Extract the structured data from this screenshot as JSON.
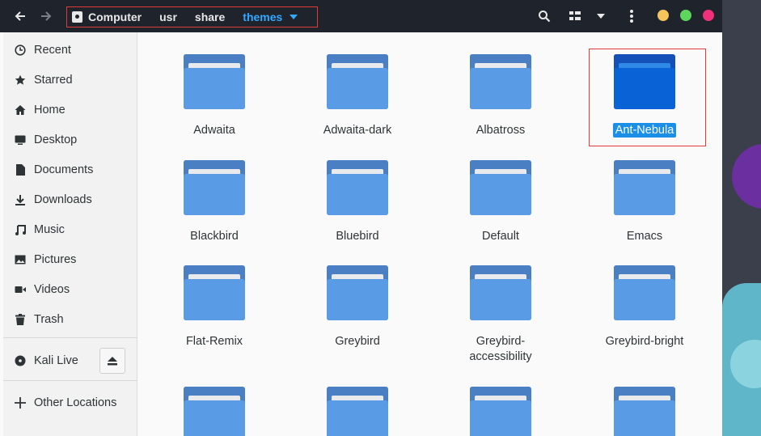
{
  "header": {
    "breadcrumbs": [
      "Computer",
      "usr",
      "share",
      "themes"
    ],
    "icons": {
      "back": "arrow-left-icon",
      "forward": "arrow-right-icon",
      "search": "search-icon",
      "view": "view-options-icon",
      "sort": "chevron-down-icon",
      "menu": "kebab-menu-icon"
    },
    "window_controls": {
      "minimize_color": "#f4c55b",
      "maximize_color": "#5ed65e",
      "close_color": "#f0307a"
    }
  },
  "sidebar": {
    "places": [
      {
        "label": "Recent",
        "icon": "clock-icon"
      },
      {
        "label": "Starred",
        "icon": "star-icon"
      },
      {
        "label": "Home",
        "icon": "home-icon"
      },
      {
        "label": "Desktop",
        "icon": "desktop-icon"
      },
      {
        "label": "Documents",
        "icon": "document-icon"
      },
      {
        "label": "Downloads",
        "icon": "download-icon"
      },
      {
        "label": "Music",
        "icon": "music-icon"
      },
      {
        "label": "Pictures",
        "icon": "picture-icon"
      },
      {
        "label": "Videos",
        "icon": "video-icon"
      },
      {
        "label": "Trash",
        "icon": "trash-icon"
      }
    ],
    "devices": [
      {
        "label": "Kali Live",
        "icon": "disc-icon"
      }
    ],
    "other": {
      "label": "Other Locations",
      "icon": "plus-icon"
    }
  },
  "files": [
    {
      "name": "Adwaita",
      "selected": false
    },
    {
      "name": "Adwaita-dark",
      "selected": false
    },
    {
      "name": "Albatross",
      "selected": false
    },
    {
      "name": "Ant-Nebula",
      "selected": true
    },
    {
      "name": "Blackbird",
      "selected": false
    },
    {
      "name": "Bluebird",
      "selected": false
    },
    {
      "name": "Default",
      "selected": false
    },
    {
      "name": "Emacs",
      "selected": false
    },
    {
      "name": "Flat-Remix",
      "selected": false
    },
    {
      "name": "Greybird",
      "selected": false
    },
    {
      "name": "Greybird-accessibility",
      "display": [
        "Greybird-",
        "accessibility"
      ],
      "selected": false
    },
    {
      "name": "Greybird-bright",
      "selected": false
    }
  ],
  "colors": {
    "accent": "#33a8ff",
    "selection": "#1a8fe8",
    "folder": "#5a9be6",
    "highlight_border": "#e03a3a"
  }
}
